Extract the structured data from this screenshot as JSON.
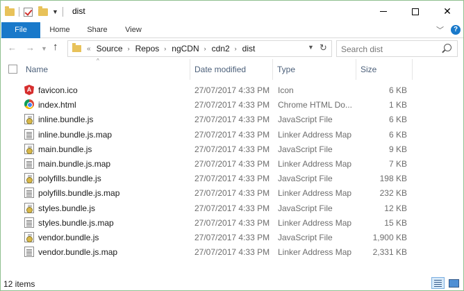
{
  "window": {
    "title": "dist",
    "minimize_glyph": "",
    "maximize_glyph": "",
    "close_glyph": "✕"
  },
  "ribbon": {
    "tabs": [
      {
        "label": "File"
      },
      {
        "label": "Home"
      },
      {
        "label": "Share"
      },
      {
        "label": "View"
      }
    ],
    "help": "?"
  },
  "address": {
    "overflow": "«",
    "crumbs": [
      "Source",
      "Repos",
      "ngCDN",
      "cdn2",
      "dist"
    ]
  },
  "search": {
    "placeholder": "Search dist"
  },
  "columns": {
    "name": "Name",
    "date": "Date modified",
    "type": "Type",
    "size": "Size"
  },
  "files": [
    {
      "name": "favicon.ico",
      "date": "27/07/2017 4:33 PM",
      "type": "Icon",
      "size": "6 KB",
      "icon": "angular-icon"
    },
    {
      "name": "index.html",
      "date": "27/07/2017 4:33 PM",
      "type": "Chrome HTML Do...",
      "size": "1 KB",
      "icon": "chrome-icon"
    },
    {
      "name": "inline.bundle.js",
      "date": "27/07/2017 4:33 PM",
      "type": "JavaScript File",
      "size": "6 KB",
      "icon": "js-file-icon"
    },
    {
      "name": "inline.bundle.js.map",
      "date": "27/07/2017 4:33 PM",
      "type": "Linker Address Map",
      "size": "6 KB",
      "icon": "map-file-icon"
    },
    {
      "name": "main.bundle.js",
      "date": "27/07/2017 4:33 PM",
      "type": "JavaScript File",
      "size": "9 KB",
      "icon": "js-file-icon"
    },
    {
      "name": "main.bundle.js.map",
      "date": "27/07/2017 4:33 PM",
      "type": "Linker Address Map",
      "size": "7 KB",
      "icon": "map-file-icon"
    },
    {
      "name": "polyfills.bundle.js",
      "date": "27/07/2017 4:33 PM",
      "type": "JavaScript File",
      "size": "198 KB",
      "icon": "js-file-icon"
    },
    {
      "name": "polyfills.bundle.js.map",
      "date": "27/07/2017 4:33 PM",
      "type": "Linker Address Map",
      "size": "232 KB",
      "icon": "map-file-icon"
    },
    {
      "name": "styles.bundle.js",
      "date": "27/07/2017 4:33 PM",
      "type": "JavaScript File",
      "size": "12 KB",
      "icon": "js-file-icon"
    },
    {
      "name": "styles.bundle.js.map",
      "date": "27/07/2017 4:33 PM",
      "type": "Linker Address Map",
      "size": "15 KB",
      "icon": "map-file-icon"
    },
    {
      "name": "vendor.bundle.js",
      "date": "27/07/2017 4:33 PM",
      "type": "JavaScript File",
      "size": "1,900 KB",
      "icon": "js-file-icon"
    },
    {
      "name": "vendor.bundle.js.map",
      "date": "27/07/2017 4:33 PM",
      "type": "Linker Address Map",
      "size": "2,331 KB",
      "icon": "map-file-icon"
    }
  ],
  "status": {
    "item_count": "12 items"
  },
  "colors": {
    "file_tab": "#1979ca",
    "folder": "#e8c25a",
    "header_text": "#4c607a",
    "window_border": "#8fbf8f"
  }
}
